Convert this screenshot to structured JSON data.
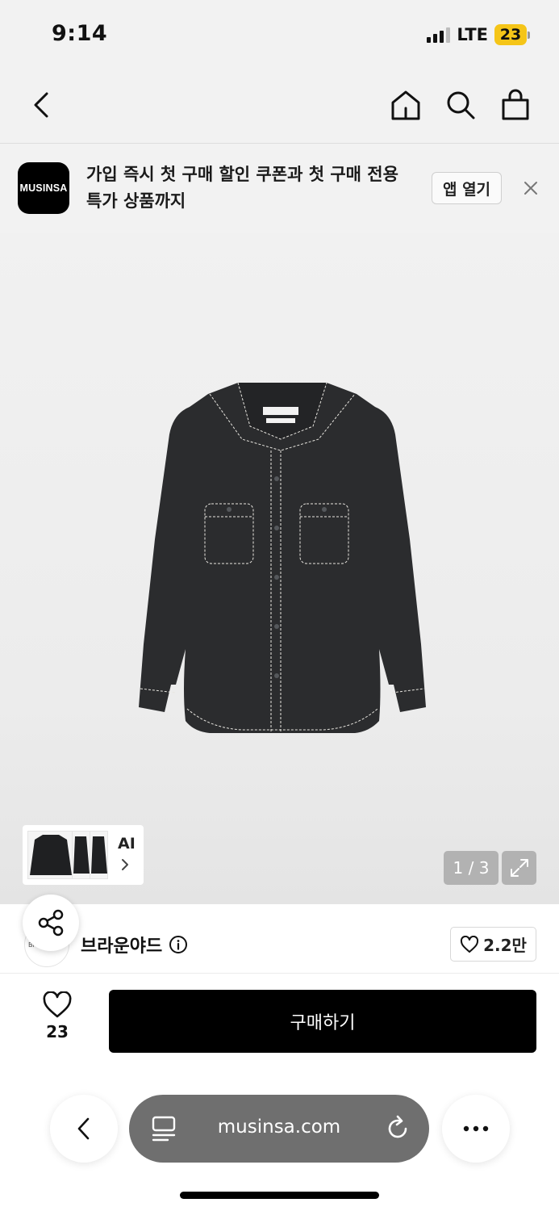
{
  "status_bar": {
    "time": "9:14",
    "network": "LTE",
    "battery": "23"
  },
  "nav": {
    "back_icon": "chevron-left-icon",
    "home_icon": "home-icon",
    "search_icon": "search-icon",
    "cart_icon": "shopping-bag-icon"
  },
  "app_banner": {
    "logo_text": "MUSINSA",
    "message": "가입 즉시 첫 구매 할인 쿠폰과 첫 구매 전용 특가 상품까지",
    "open_app_label": "앱 열기",
    "close_icon": "close-icon"
  },
  "product": {
    "image_label": "BROWNYARD",
    "thumbnail_ai_label": "AI",
    "page_indicator": "1 / 3",
    "page_current": 1,
    "page_total": 3
  },
  "brand": {
    "avatar_text": "Bro",
    "name": "브라운야드",
    "like_count": "2.2만"
  },
  "purchase": {
    "wish_count": "23",
    "buy_label": "구매하기"
  },
  "browser": {
    "url": "musinsa.com"
  },
  "colors": {
    "accent_black": "#000000",
    "battery_yellow": "#f5c518",
    "url_pill": "#6f6f6f"
  }
}
